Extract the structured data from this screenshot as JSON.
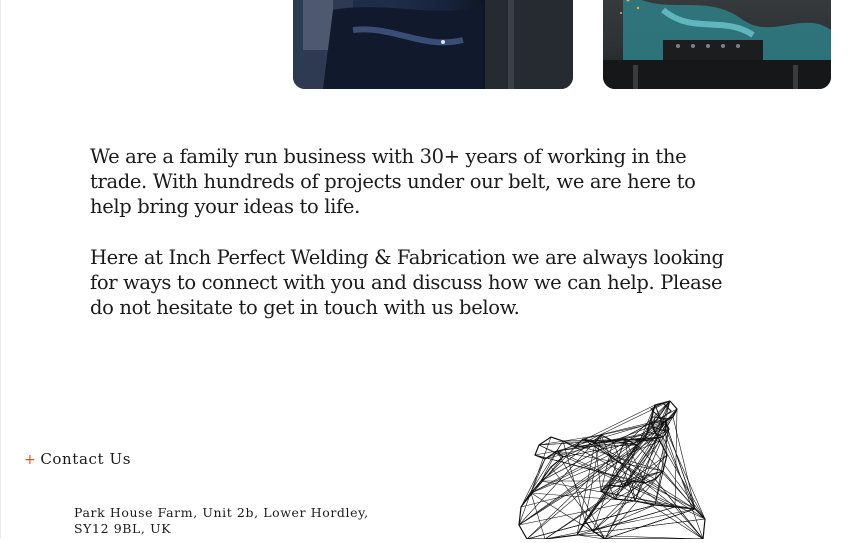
{
  "intro": {
    "paragraph_1": "We are a family run business with 30+ years of working in the trade. With hundreds of projects under our belt, we are here to help bring your ideas to life.",
    "paragraph_2": "Here at Inch Perfect Welding & Fabrication we are always looking for ways to connect with you and discuss how we can help. Please do not hesitate to get in touch with us below."
  },
  "contact": {
    "plus_symbol": "+",
    "heading": "Contact Us",
    "address_line_1": "Park House Farm, Unit 2b, Lower Hordley,",
    "address_line_2": "SY12 9BL, UK"
  },
  "colors": {
    "accent": "#d9552b",
    "text": "#1a1a1a",
    "background": "#ffffff"
  },
  "icons": {
    "plus": "plus-icon",
    "map": "uk-map-line-art"
  }
}
